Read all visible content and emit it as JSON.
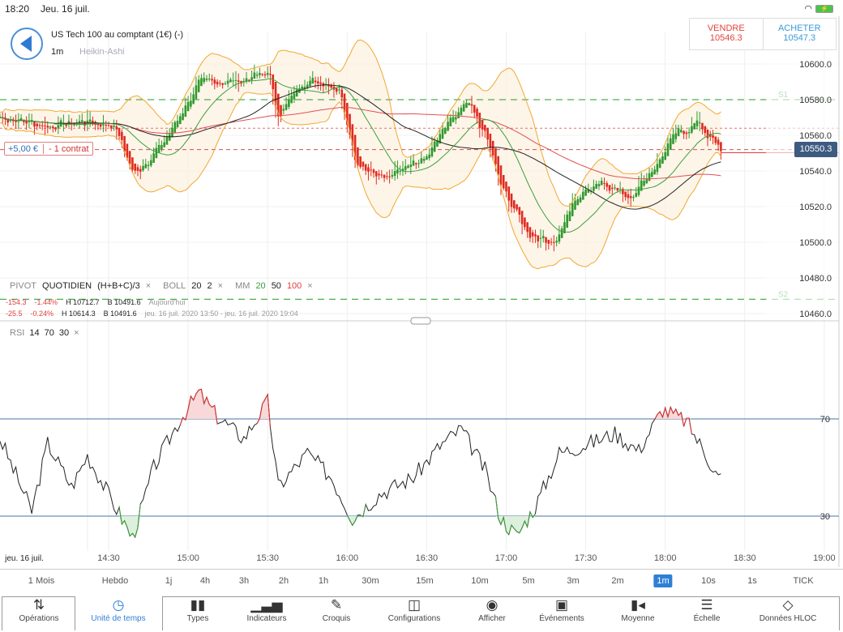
{
  "status": {
    "time": "18:20",
    "date": "Jeu. 16 juil."
  },
  "instrument": {
    "title": "US Tech 100 au comptant (1€) (-)",
    "timeframe": "1m",
    "chart_type": "Heikin-Ashi"
  },
  "trade": {
    "sell_label": "VENDRE",
    "sell_price": "10546.3",
    "buy_label": "ACHETER",
    "buy_price": "10547.3"
  },
  "position": {
    "pl": "+5,00 €",
    "contracts": "- 1 contrat"
  },
  "current_price": "10550.3",
  "indicators": {
    "pivot": "PIVOT",
    "pivot_period": "QUOTIDIEN",
    "pivot_formula": "(H+B+C)/3",
    "boll": "BOLL",
    "boll_p1": "20",
    "boll_p2": "2",
    "mm": "MM",
    "mm1": "20",
    "mm2": "50",
    "mm3": "100",
    "close": "×"
  },
  "stats": [
    {
      "chg": "-154.3",
      "pct": "-1.44%",
      "h": "H 10712.7",
      "b": "B 10491.6",
      "period": "Aujourd'hui"
    },
    {
      "chg": "-25.5",
      "pct": "-0.24%",
      "h": "H 10614.3",
      "b": "B 10491.6",
      "period": "jeu. 16 juil. 2020 13:50 - jeu. 16 juil. 2020 19:04"
    }
  ],
  "rsi": {
    "label": "RSI",
    "p1": "14",
    "p2": "70",
    "p3": "30",
    "close": "×"
  },
  "timeframes": [
    "1 Mois",
    "Hebdo",
    "1j",
    "4h",
    "3h",
    "2h",
    "1h",
    "30m",
    "15m",
    "10m",
    "5m",
    "3m",
    "2m",
    "1m",
    "10s",
    "1s",
    "TICK"
  ],
  "active_timeframe": "1m",
  "toolbar": [
    {
      "label": "Opérations",
      "icon": "arrows-up-down-icon"
    },
    {
      "label": "Unité de temps",
      "icon": "clock-icon"
    },
    {
      "label": "Types",
      "icon": "candles-icon"
    },
    {
      "label": "Indicateurs",
      "icon": "bar-chart-icon"
    },
    {
      "label": "Croquis",
      "icon": "pencil-icon"
    },
    {
      "label": "Configurations",
      "icon": "layout-icon"
    },
    {
      "label": "Afficher",
      "icon": "eye-icon"
    },
    {
      "label": "Événements",
      "icon": "calendar-icon"
    },
    {
      "label": "Moyenne",
      "icon": "average-icon"
    },
    {
      "label": "Échelle",
      "icon": "scale-icon"
    },
    {
      "label": "Données HLOC",
      "icon": "crosshair-icon"
    }
  ],
  "colors": {
    "up": "#2e9a2e",
    "down": "#e02a20",
    "boll": "#f0a830",
    "mm20": "#3aa03a",
    "mm50": "#222222",
    "mm100": "#e05050",
    "pivot": "#4caf50",
    "rsi_band": "#6a8fb8",
    "accent": "#2f7fd6"
  },
  "chart_data": {
    "type": "candlestick",
    "price_axis": {
      "ticks": [
        "10600.0",
        "10580.0",
        "10560.0",
        "10540.0",
        "10520.0",
        "10500.0",
        "10480.0",
        "10460.0"
      ],
      "range": [
        10455,
        10610
      ]
    },
    "time_axis": {
      "ticks": [
        "jeu. 16 juil.",
        "14:30",
        "15:00",
        "15:30",
        "16:00",
        "16:30",
        "17:00",
        "17:30",
        "18:00",
        "18:30",
        "19:00"
      ]
    },
    "pivot_lines": [
      {
        "name": "S1",
        "value": 10580
      },
      {
        "name": "S2",
        "value": 10468
      }
    ],
    "order_line": 10564,
    "entry_line": 10552,
    "price_path": [
      [
        "13:49",
        10570
      ],
      [
        "14:07",
        10565
      ],
      [
        "14:20",
        10568
      ],
      [
        "14:32",
        10565
      ],
      [
        "14:39",
        10538
      ],
      [
        "14:50",
        10555
      ],
      [
        "15:04",
        10590
      ],
      [
        "15:17",
        10590
      ],
      [
        "15:30",
        10595
      ],
      [
        "15:34",
        10570
      ],
      [
        "15:42",
        10590
      ],
      [
        "15:51",
        10590
      ],
      [
        "15:57",
        10585
      ],
      [
        "16:03",
        10545
      ],
      [
        "16:13",
        10535
      ],
      [
        "16:22",
        10545
      ],
      [
        "16:28",
        10545
      ],
      [
        "16:37",
        10565
      ],
      [
        "16:45",
        10578
      ],
      [
        "16:52",
        10560
      ],
      [
        "16:58",
        10530
      ],
      [
        "17:08",
        10505
      ],
      [
        "17:18",
        10500
      ],
      [
        "17:26",
        10525
      ],
      [
        "17:35",
        10535
      ],
      [
        "17:46",
        10525
      ],
      [
        "17:57",
        10545
      ],
      [
        "18:03",
        10560
      ],
      [
        "18:12",
        10567
      ],
      [
        "18:21",
        10550
      ]
    ],
    "rsi_axis": {
      "ticks": [
        "70",
        "30"
      ]
    },
    "rsi_path": [
      [
        "13:49",
        62
      ],
      [
        "14:01",
        32
      ],
      [
        "14:07",
        60
      ],
      [
        "14:16",
        42
      ],
      [
        "14:22",
        55
      ],
      [
        "14:35",
        29
      ],
      [
        "14:39",
        21
      ],
      [
        "14:47",
        50
      ],
      [
        "14:56",
        68
      ],
      [
        "15:04",
        81
      ],
      [
        "15:11",
        71
      ],
      [
        "15:21",
        62
      ],
      [
        "15:30",
        77
      ],
      [
        "15:34",
        42
      ],
      [
        "15:45",
        56
      ],
      [
        "15:54",
        46
      ],
      [
        "16:02",
        29
      ],
      [
        "16:12",
        39
      ],
      [
        "16:25",
        46
      ],
      [
        "16:35",
        59
      ],
      [
        "16:43",
        66
      ],
      [
        "16:52",
        49
      ],
      [
        "16:58",
        29
      ],
      [
        "17:04",
        22
      ],
      [
        "17:11",
        34
      ],
      [
        "17:20",
        56
      ],
      [
        "17:29",
        59
      ],
      [
        "17:41",
        64
      ],
      [
        "17:50",
        57
      ],
      [
        "17:59",
        74
      ],
      [
        "18:08",
        69
      ],
      [
        "18:15",
        56
      ],
      [
        "18:20",
        46
      ]
    ]
  }
}
